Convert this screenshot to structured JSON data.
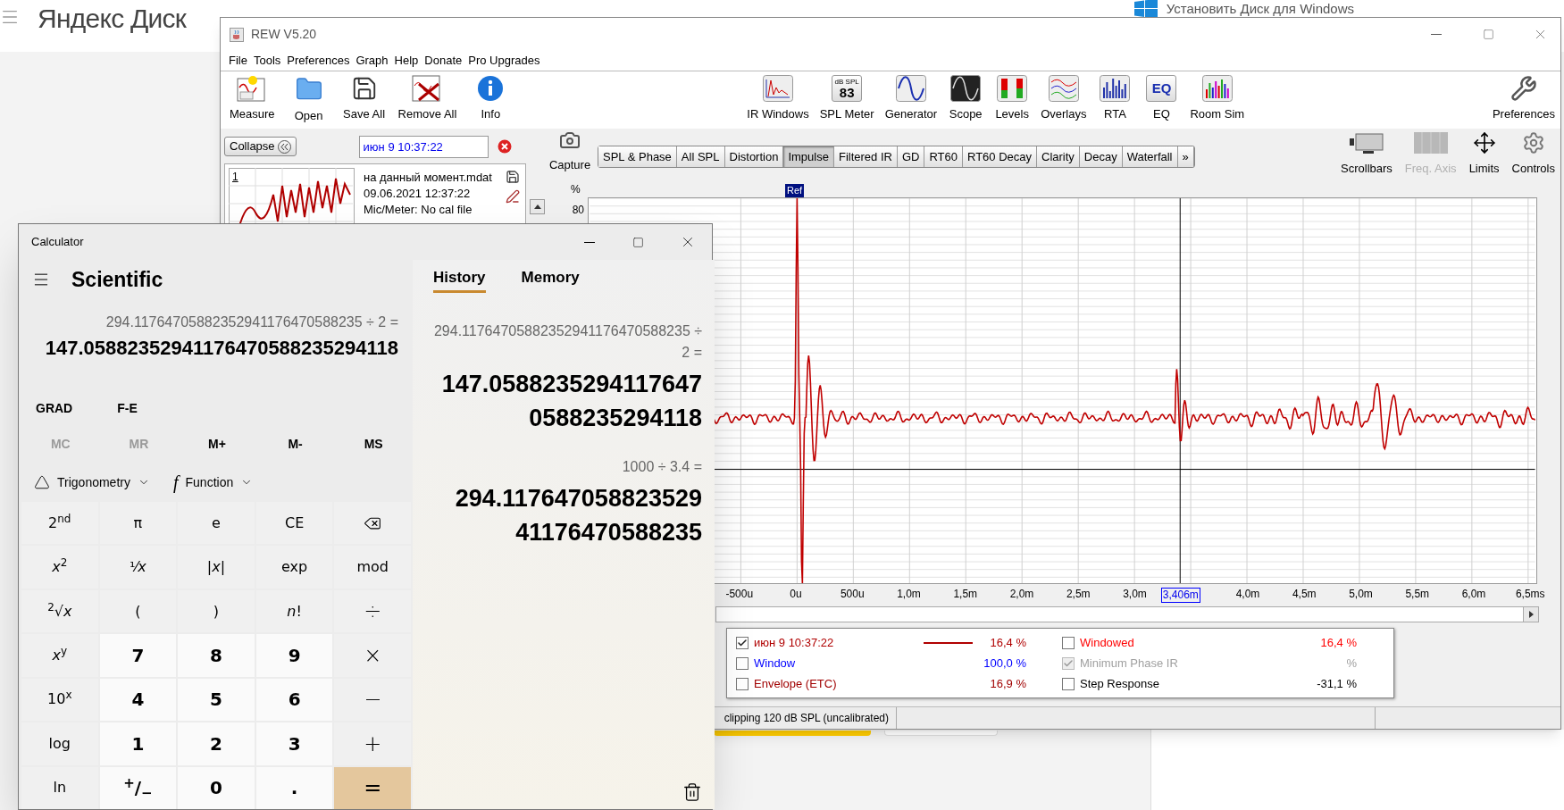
{
  "page": {
    "logo": "Яндекс Диск",
    "install_link": "Установить Диск для Windows"
  },
  "rew": {
    "title": "REW V5.20",
    "menu": [
      "File",
      "Tools",
      "Preferences",
      "Graph",
      "Help",
      "Donate",
      "Pro Upgrades"
    ],
    "toolbar_left": [
      "Measure",
      "Open",
      "Save All",
      "Remove All",
      "Info"
    ],
    "toolbar_middle": [
      {
        "label": "IR Windows",
        "kind": "ir"
      },
      {
        "label": "SPL Meter",
        "kind": "meter",
        "meter_unit": "dB SPL",
        "meter_reading": "83"
      },
      {
        "label": "Generator",
        "kind": "generator"
      },
      {
        "label": "Scope",
        "kind": "scope"
      },
      {
        "label": "Levels",
        "kind": "levels"
      },
      {
        "label": "Overlays",
        "kind": "overlays"
      },
      {
        "label": "RTA",
        "kind": "rta"
      },
      {
        "label": "EQ",
        "kind": "eq",
        "logo": "EQ"
      },
      {
        "label": "Room Sim",
        "kind": "roomsim"
      }
    ],
    "toolbar_right": "Preferences",
    "collapse_button": "Collapse",
    "measurement": {
      "name": "июн 9 10:37:22",
      "index": "1",
      "lines": [
        "на данный момент.mdat",
        "09.06.2021 12:37:22",
        "Mic/Meter: No cal file"
      ]
    },
    "capture": "Capture",
    "graph_tabs": [
      {
        "label": "SPL & Phase",
        "selected": false
      },
      {
        "label": "All SPL",
        "selected": false
      },
      {
        "label": "Distortion",
        "selected": false
      },
      {
        "label": "Impulse",
        "selected": true
      },
      {
        "label": "Filtered IR",
        "selected": false
      },
      {
        "label": "GD",
        "selected": false
      },
      {
        "label": "RT60",
        "selected": false
      },
      {
        "label": "RT60 Decay",
        "selected": false
      },
      {
        "label": "Clarity",
        "selected": false
      },
      {
        "label": "Decay",
        "selected": false
      },
      {
        "label": "Waterfall",
        "selected": false
      },
      {
        "label": "»",
        "selected": false
      }
    ],
    "view_buttons": [
      {
        "label": "Scrollbars",
        "disabled": false
      },
      {
        "label": "Freq. Axis",
        "disabled": true
      },
      {
        "label": "Limits",
        "disabled": false
      },
      {
        "label": "Controls",
        "disabled": false
      }
    ],
    "y_unit": "%",
    "y_tick": "80",
    "ref_marker": "Ref",
    "x_ticks": [
      {
        "label": "-500u",
        "kind": "tick"
      },
      {
        "label": "0u",
        "kind": "tick"
      },
      {
        "label": "500u",
        "kind": "tick"
      },
      {
        "label": "1,0m",
        "kind": "tick"
      },
      {
        "label": "1,5m",
        "kind": "tick"
      },
      {
        "label": "2,0m",
        "kind": "tick"
      },
      {
        "label": "2,5m",
        "kind": "tick"
      },
      {
        "label": "3,0m",
        "kind": "tick"
      },
      {
        "label": "3,406m",
        "kind": "cursor"
      },
      {
        "label": "4,0m",
        "kind": "tick"
      },
      {
        "label": "4,5m",
        "kind": "tick"
      },
      {
        "label": "5,0m",
        "kind": "tick"
      },
      {
        "label": "5,5m",
        "kind": "tick"
      },
      {
        "label": "6,0m",
        "kind": "tick"
      },
      {
        "label": "6,5ms",
        "kind": "tick"
      }
    ],
    "legend": [
      {
        "label": "июн 9 10:37:22",
        "kind": "trace",
        "checked": true,
        "disabled": false,
        "value": "16,4 %",
        "color": "#b00000"
      },
      {
        "label": "Windowed",
        "kind": "option",
        "checked": false,
        "disabled": false,
        "value": "16,4 %",
        "color": "#ff0000"
      },
      {
        "label": "Window",
        "kind": "option",
        "checked": false,
        "disabled": false,
        "value": "100,0 %",
        "color": "#0000ff"
      },
      {
        "label": "Minimum Phase IR",
        "kind": "option",
        "checked": true,
        "disabled": true,
        "value": "%",
        "color": "#a0a0a0"
      },
      {
        "label": "Envelope (ETC)",
        "kind": "option",
        "checked": false,
        "disabled": false,
        "value": "16,9 %",
        "color": "#a00000"
      },
      {
        "label": "Step Response",
        "kind": "option",
        "checked": false,
        "disabled": false,
        "value": "-31,1 %",
        "color": "#000000"
      }
    ],
    "status": "clipping 120 dB SPL (uncalibrated)"
  },
  "calculator": {
    "title": "Calculator",
    "mode": "Scientific",
    "expression": "294.11764705882352941176470588235 ÷ 2 =",
    "result": "147.05882352941176470588235294118",
    "settings": [
      "GRAD",
      "F-E"
    ],
    "memory_buttons": [
      {
        "label": "MC",
        "disabled": true
      },
      {
        "label": "MR",
        "disabled": true
      },
      {
        "label": "M+",
        "disabled": false
      },
      {
        "label": "M-",
        "disabled": false
      },
      {
        "label": "MS",
        "disabled": false
      }
    ],
    "dropdowns": [
      {
        "label": "Trigonometry"
      },
      {
        "label": "Function",
        "glyph": "f"
      }
    ],
    "keys": [
      {
        "label": "2$^{nd}$",
        "kind": "func"
      },
      {
        "label": "π",
        "kind": "func"
      },
      {
        "label": "e",
        "kind": "func"
      },
      {
        "label": "CE",
        "kind": "func"
      },
      {
        "kind": "backspace"
      },
      {
        "label": "*x*$^{2}$",
        "kind": "func"
      },
      {
        "label": "¹⁄*x*",
        "kind": "func"
      },
      {
        "label": "|*x*|",
        "kind": "func"
      },
      {
        "label": "exp",
        "kind": "func"
      },
      {
        "label": "mod",
        "kind": "func"
      },
      {
        "label": "$^{2}$√*x*",
        "kind": "func"
      },
      {
        "label": "(",
        "kind": "func"
      },
      {
        "label": ")",
        "kind": "func"
      },
      {
        "label": "*n*!",
        "kind": "func"
      },
      {
        "label": "÷",
        "kind": "op"
      },
      {
        "label": "*x*$^{y}$",
        "kind": "func"
      },
      {
        "label": "7",
        "kind": "digit"
      },
      {
        "label": "8",
        "kind": "digit"
      },
      {
        "label": "9",
        "kind": "digit"
      },
      {
        "label": "×",
        "kind": "op"
      },
      {
        "label": "10$^{x}$",
        "kind": "func"
      },
      {
        "label": "4",
        "kind": "digit"
      },
      {
        "label": "5",
        "kind": "digit"
      },
      {
        "label": "6",
        "kind": "digit"
      },
      {
        "label": "−",
        "kind": "op"
      },
      {
        "label": "log",
        "kind": "func"
      },
      {
        "label": "1",
        "kind": "digit"
      },
      {
        "label": "2",
        "kind": "digit"
      },
      {
        "label": "3",
        "kind": "digit"
      },
      {
        "label": "+",
        "kind": "op"
      },
      {
        "label": "ln",
        "kind": "func"
      },
      {
        "label": "$^{+}$/$_{−}$",
        "kind": "digit"
      },
      {
        "label": "0",
        "kind": "digit"
      },
      {
        "label": ".",
        "kind": "digit"
      },
      {
        "label": "=",
        "kind": "equals"
      }
    ],
    "panel_tabs": [
      {
        "label": "History",
        "selected": true
      },
      {
        "label": "Memory",
        "selected": false
      }
    ],
    "history": [
      {
        "expression": "294.11764705882352941176470588235 ÷ 2 =",
        "result": "147.0588235294117647 0588235294118"
      },
      {
        "expression": "1000 ÷ 3.4 =",
        "result": "294.117647058823529 41176470588235"
      }
    ]
  }
}
